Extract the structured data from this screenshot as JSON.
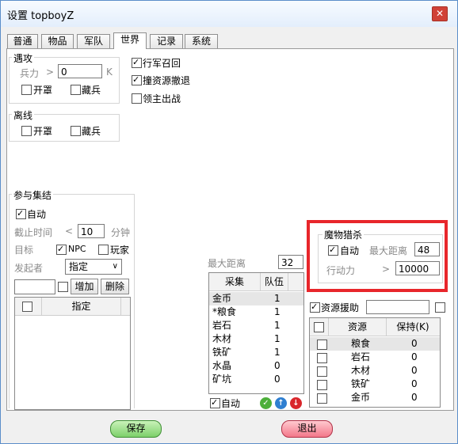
{
  "window": {
    "title": "设置 topboyZ",
    "close_icon": "close-icon"
  },
  "tabs": [
    "普通",
    "物品",
    "军队",
    "世界",
    "记录",
    "系统"
  ],
  "active_tab": "世界",
  "encounter": {
    "title": "遇攻",
    "troops_label": "兵力",
    "gt": ">",
    "troops_value": "0",
    "unit": "K",
    "open_cover_label": "开罩",
    "hide_troops_label": "藏兵",
    "march_recall_label": "行军召回",
    "resource_retreat_label": "撞资源撤退",
    "lord_out_label": "领主出战",
    "march_recall_checked": true,
    "resource_retreat_checked": true,
    "lord_out_checked": false
  },
  "offline": {
    "title": "离线",
    "open_cover_label": "开罩",
    "hide_troops_label": "藏兵"
  },
  "rally": {
    "title": "参与集结",
    "auto_label": "自动",
    "auto_checked": true,
    "deadline_label": "截止时间",
    "lt": "<",
    "deadline_value": "10",
    "minutes_label": "分钟",
    "target_label": "目标",
    "npc_label": "NPC",
    "npc_checked": true,
    "player_label": "玩家",
    "player_checked": false,
    "initiator_label": "发起者",
    "initiator_select": "指定",
    "add_label": "增加",
    "delete_label": "删除",
    "list_header": "指定"
  },
  "gather": {
    "max_distance_label": "最大距离",
    "max_distance_value": "32",
    "col_gather": "采集",
    "col_team": "队伍",
    "rows": [
      {
        "name": "金币",
        "count": "1"
      },
      {
        "name": "*粮食",
        "count": "1"
      },
      {
        "name": "岩石",
        "count": "1"
      },
      {
        "name": "木材",
        "count": "1"
      },
      {
        "name": "铁矿",
        "count": "1"
      },
      {
        "name": "水晶",
        "count": "0"
      },
      {
        "name": "矿坑",
        "count": "0"
      }
    ],
    "auto_label": "自动",
    "auto_checked": true,
    "icons": [
      "check-icon",
      "up-arrow-icon",
      "down-arrow-icon"
    ]
  },
  "monster": {
    "title": "魔物猎杀",
    "auto_label": "自动",
    "auto_checked": true,
    "max_distance_label": "最大距离",
    "max_distance_value": "48",
    "stamina_label": "行动力",
    "gt": ">",
    "stamina_value": "10000"
  },
  "resource_aid": {
    "label": "资源援助",
    "checked": true,
    "input_value": "",
    "col_resource": "资源",
    "col_keep": "保持(K)",
    "rows": [
      {
        "name": "粮食",
        "keep": "0"
      },
      {
        "name": "岩石",
        "keep": "0"
      },
      {
        "name": "木材",
        "keep": "0"
      },
      {
        "name": "铁矿",
        "keep": "0"
      },
      {
        "name": "金币",
        "keep": "0"
      }
    ]
  },
  "footer": {
    "save_label": "保存",
    "exit_label": "退出"
  },
  "colors": {
    "highlight_box": "#e8262b",
    "save": "#7dd06a",
    "exit": "#f3788a"
  }
}
